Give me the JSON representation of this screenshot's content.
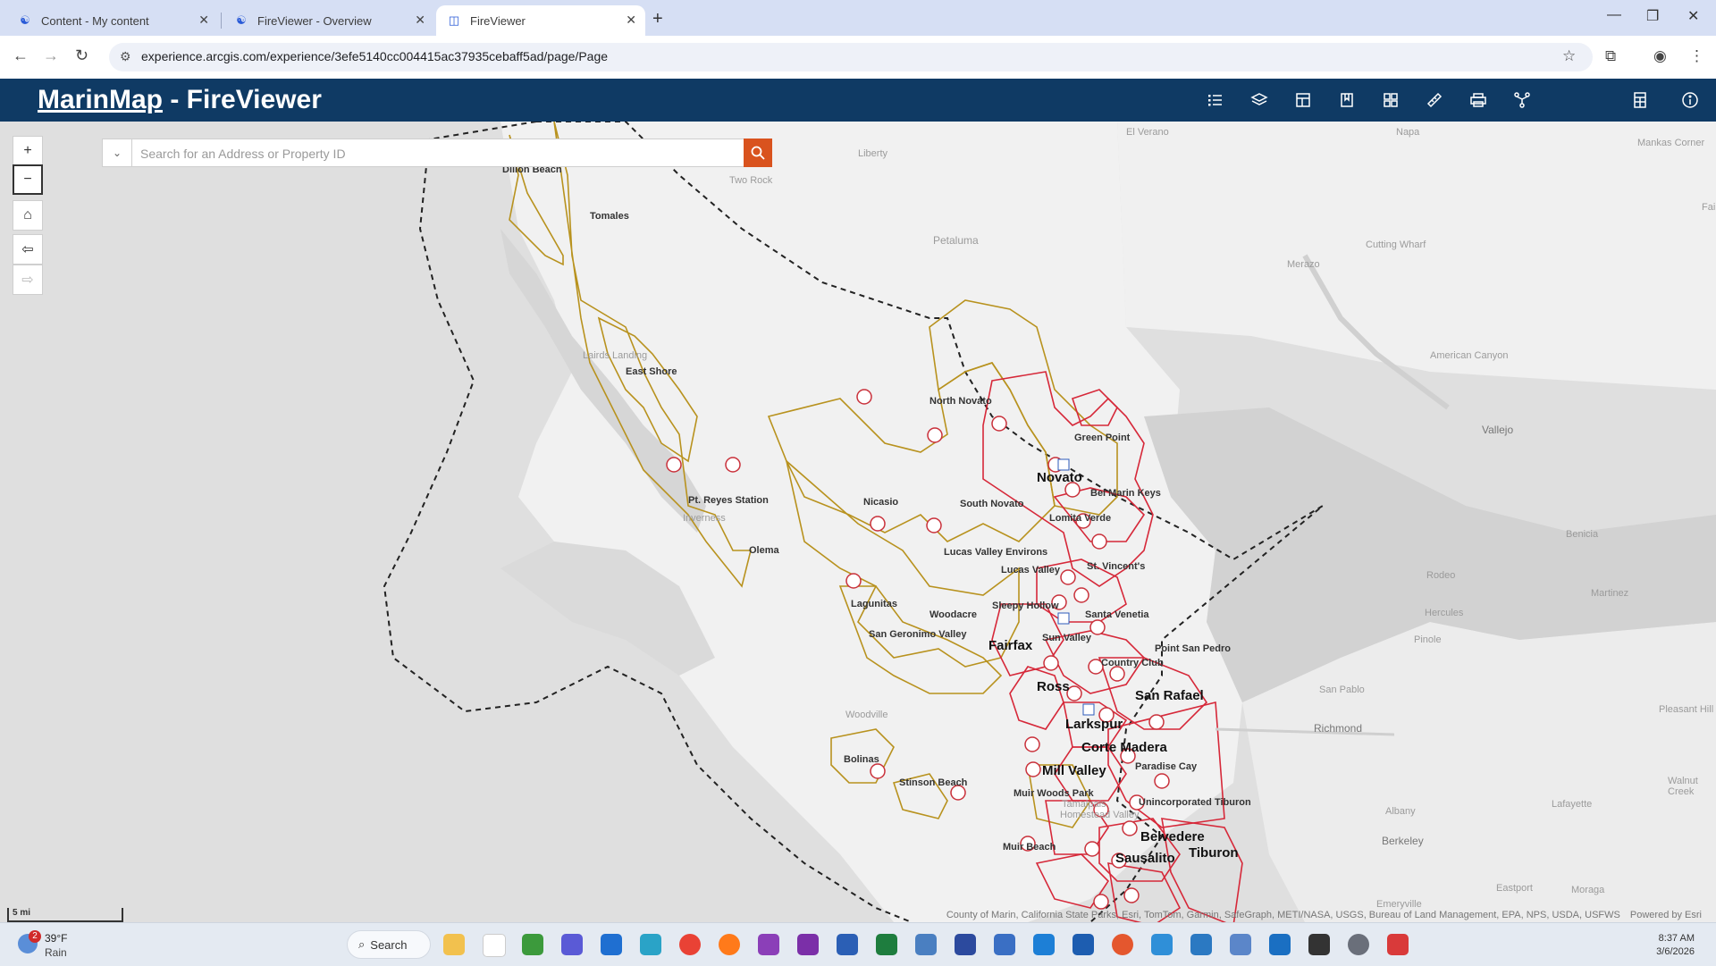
{
  "browser": {
    "tabs": [
      {
        "label": "Content - My content",
        "active": false
      },
      {
        "label": "FireViewer - Overview",
        "active": false
      },
      {
        "label": "FireViewer",
        "active": true
      }
    ],
    "url": "experience.arcgis.com/experience/3efe5140cc004415ac37935cebaff5ad/page/Page"
  },
  "app": {
    "title_link": "MarinMap",
    "title_rest": " - FireViewer",
    "header_icons": [
      "legend-icon",
      "layers-icon",
      "table-icon",
      "bookmark-icon",
      "basemap-gallery-icon",
      "measure-icon",
      "print-icon",
      "share-icon",
      "calculator-icon",
      "info-icon"
    ]
  },
  "search": {
    "placeholder": "Search for an Address or Property ID"
  },
  "map": {
    "controls": [
      "zoom-in",
      "zoom-out",
      "home",
      "previous-extent",
      "next-extent"
    ],
    "scale_label": "5 mi",
    "attribution": "County of Marin, California State Parks, Esri, TomTom, Garmin, SafeGraph, METI/NASA, USGS, Bureau of Land Management, EPA, NPS, USDA, USFWS",
    "powered_by": "Powered by Esri",
    "background_places": [
      "El Verano",
      "Napa",
      "Mankas Corner",
      "Liberty",
      "Two Rock",
      "Petaluma",
      "Cutting Wharf",
      "Merazo",
      "American Canyon",
      "Vallejo",
      "Benicia",
      "Rodeo",
      "Martinez",
      "Hercules",
      "Pinole",
      "San Pablo",
      "Richmond",
      "Pleasant Hill",
      "Albany",
      "Lafayette",
      "Walnut Creek",
      "Berkeley",
      "Emeryville",
      "Moraga",
      "Eastport",
      "Dillon Beach",
      "Tomales",
      "Lairds Landing",
      "Inverness",
      "Woodville",
      "Olema",
      "Fai"
    ],
    "fire_districts": [
      "East Shore",
      "North Novato",
      "Novato",
      "Green Point",
      "Bel Marin Keys",
      "Lomita Verde",
      "South Novato",
      "Nicasio",
      "Pt. Reyes Station",
      "Lucas Valley Environs",
      "Lucas Valley",
      "St. Vincent's",
      "Lagunitas",
      "Woodacre",
      "Sleepy Hollow",
      "Santa Venetia",
      "San Geronimo Valley",
      "Sun Valley",
      "Fairfax",
      "Country Club",
      "Point San Pedro",
      "Ross",
      "San Rafael",
      "Larkspur",
      "Corte Madera",
      "Bolinas",
      "Mill Valley",
      "Paradise Cay",
      "Stinson Beach",
      "Muir Woods Park",
      "Tamalpais",
      "Homestead Valley",
      "Unincorporated Tiburon",
      "Belvedere",
      "Tiburon",
      "Sausalito",
      "Muir Beach"
    ]
  },
  "taskbar": {
    "weather_temp": "39°F",
    "weather_cond": "Rain",
    "weather_badge": "2",
    "search_label": "Search",
    "time": "8:37 AM",
    "date": "3/6/2026"
  }
}
